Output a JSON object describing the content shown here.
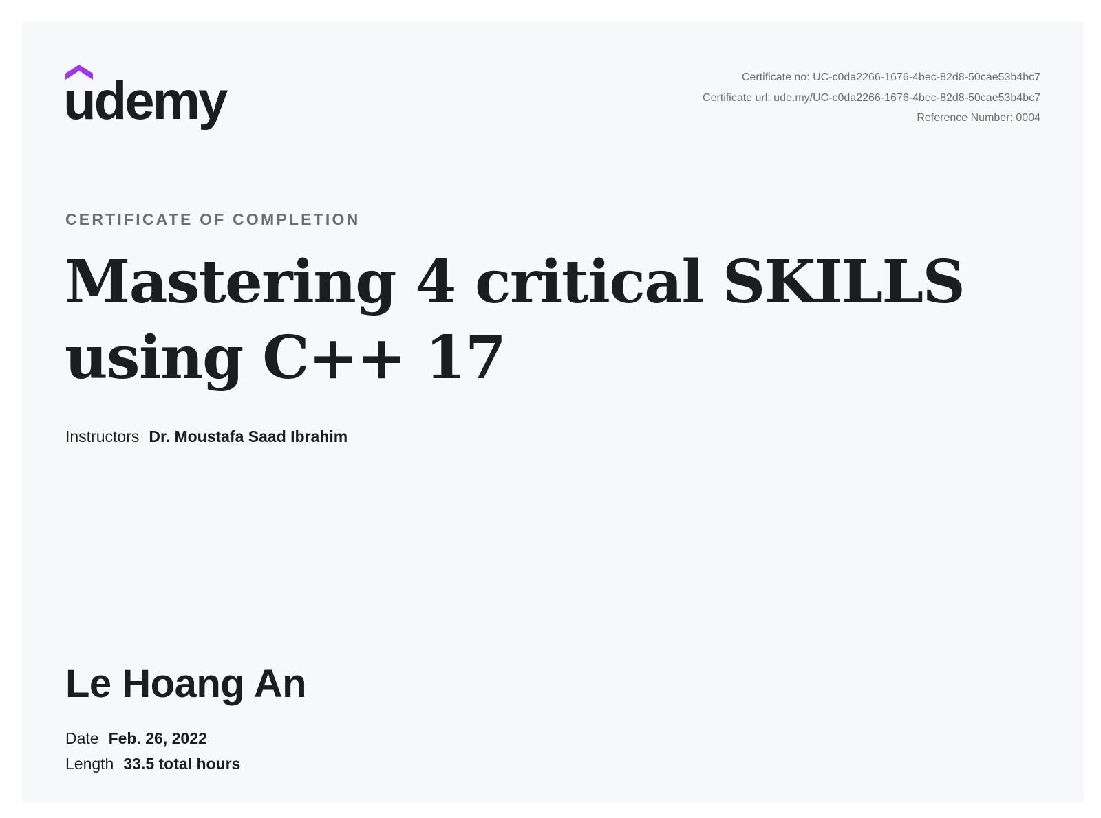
{
  "brand": {
    "logo_text": "udemy",
    "accent_color": "#a435f0",
    "logo_icon": "udemy-logo-icon"
  },
  "meta": {
    "certificate_no": "Certificate no: UC-c0da2266-1676-4bec-82d8-50cae53b4bc7",
    "certificate_url": "Certificate url: ude.my/UC-c0da2266-1676-4bec-82d8-50cae53b4bc7",
    "reference_number": "Reference Number: 0004"
  },
  "certificate": {
    "kicker": "CERTIFICATE OF COMPLETION",
    "course_title": "Mastering 4 critical SKILLS using C++ 17",
    "instructors_label": "Instructors",
    "instructors_value": "Dr. Moustafa Saad Ibrahim",
    "recipient_name": "Le Hoang An",
    "date_label": "Date",
    "date_value": "Feb. 26, 2022",
    "length_label": "Length",
    "length_value": "33.5 total hours"
  }
}
